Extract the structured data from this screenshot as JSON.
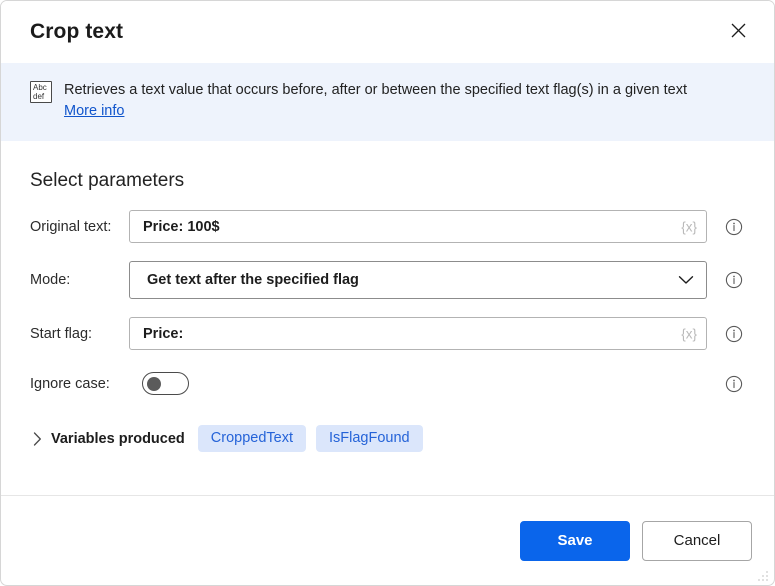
{
  "window": {
    "title": "Crop text",
    "close_icon": "close-icon"
  },
  "banner": {
    "icon": "abc-def-text-icon",
    "icon_line1": "Abc",
    "icon_line2": "def",
    "description": "Retrieves a text value that occurs before, after or between the specified text flag(s) in a given text",
    "link_label": "More info",
    "background_color": "#eef3fc",
    "link_color": "#1155cc"
  },
  "main": {
    "section_title": "Select parameters",
    "fields": [
      {
        "label": "Original text:",
        "type": "text",
        "value": "Price: 100$",
        "placeholder": "",
        "variable_glyph": "{x}",
        "info_icon": "info-icon"
      },
      {
        "label": "Mode:",
        "type": "dropdown",
        "value": "Get text after the specified flag",
        "chevron_icon": "chevron-down-icon",
        "info_icon": "info-icon"
      },
      {
        "label": "Start flag:",
        "type": "text",
        "value": "Price:",
        "placeholder": "",
        "variable_glyph": "{x}",
        "info_icon": "info-icon"
      },
      {
        "label": "Ignore case:",
        "type": "toggle",
        "value": "off",
        "info_icon": "info-icon"
      }
    ],
    "variables_produced": {
      "chevron_icon": "chevron-right-icon",
      "label": "Variables produced",
      "pills": [
        "CroppedText",
        "IsFlagFound"
      ],
      "pill_background": "#dbe6fb",
      "pill_color": "#2563d8"
    }
  },
  "footer": {
    "save_label": "Save",
    "cancel_label": "Cancel",
    "primary_color": "#0a65eb",
    "resize_grip": "resize-grip-icon"
  }
}
